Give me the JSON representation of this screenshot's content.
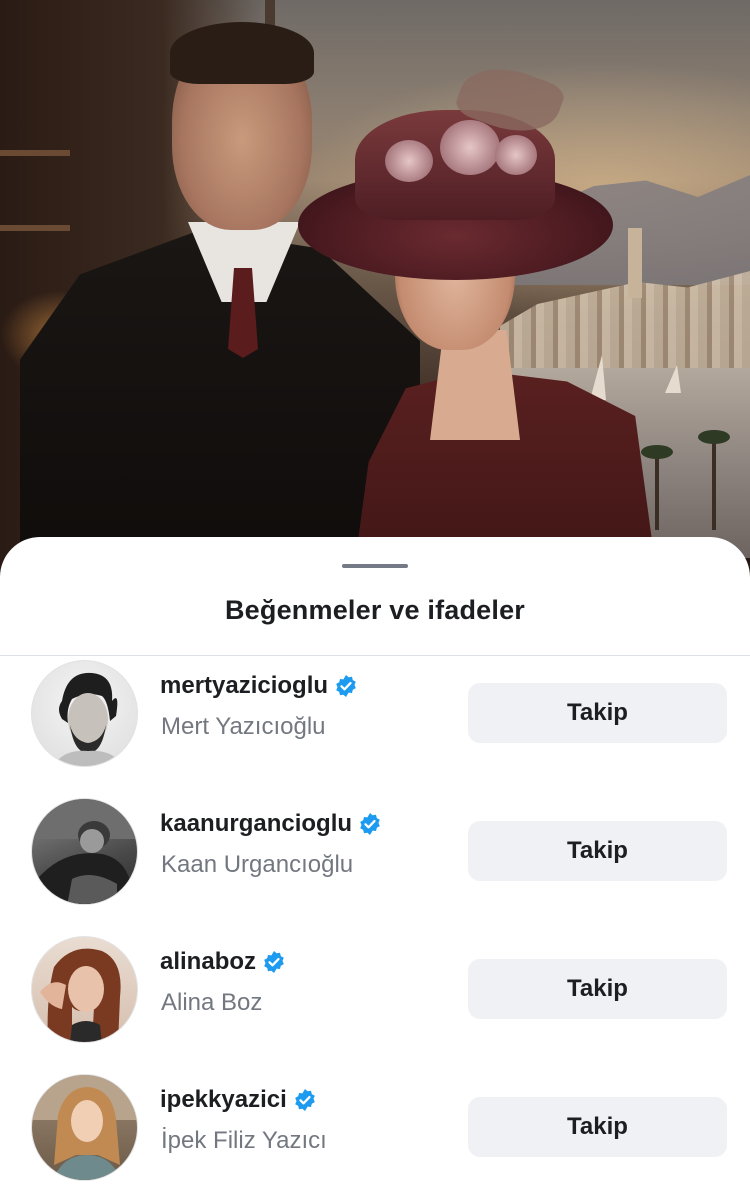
{
  "sheet": {
    "title": "Beğenmeler ve ifadeler"
  },
  "accent_color": "#1d9bf0",
  "icons": {
    "verified": "verified-badge-icon",
    "grabber": "drag-handle-icon"
  },
  "users": [
    {
      "username": "mertyazicioglu",
      "full_name": "Mert Yazıcıoğlu",
      "verified": true,
      "button_label": "Takip"
    },
    {
      "username": "kaanurgancioglu",
      "full_name": "Kaan Urgancıoğlu",
      "verified": true,
      "button_label": "Takip"
    },
    {
      "username": "alinaboz",
      "full_name": "Alina Boz",
      "verified": true,
      "button_label": "Takip"
    },
    {
      "username": "ipekkyazici",
      "full_name": "İpek Filiz Yazıcı",
      "verified": true,
      "button_label": "Takip"
    }
  ]
}
